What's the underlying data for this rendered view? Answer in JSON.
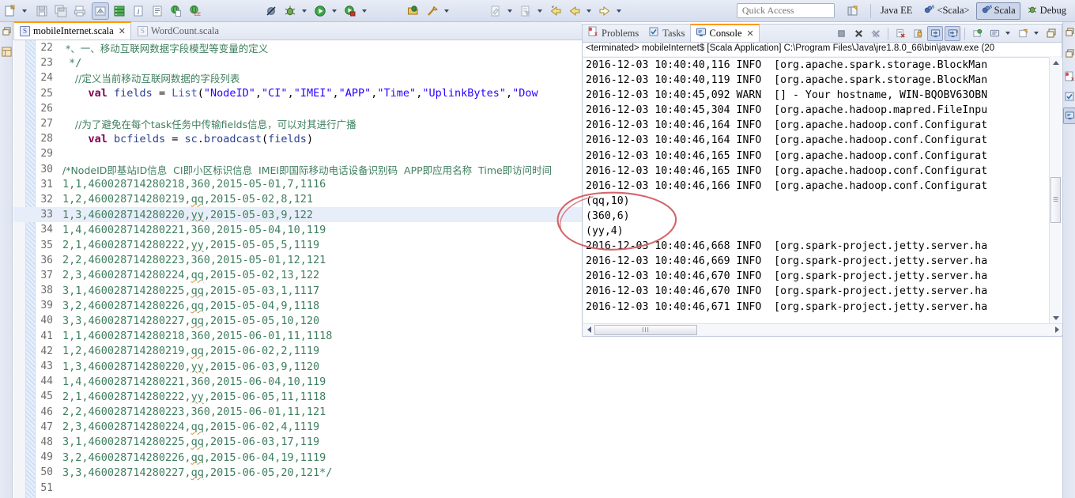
{
  "toolbar": {
    "groups": [
      {
        "name": "file-group",
        "items": [
          {
            "icon": "new-wizard-icon",
            "label": "New"
          },
          {
            "icon": "dropdown-arrow",
            "label": "New menu"
          }
        ]
      },
      {
        "name": "save-group",
        "items": [
          {
            "icon": "save-icon",
            "label": "Save"
          },
          {
            "icon": "save-all-icon",
            "label": "Save All"
          },
          {
            "icon": "print-icon",
            "label": "Print"
          }
        ]
      },
      {
        "name": "view-group",
        "items": [
          {
            "icon": "toggle-mark-occurrences-icon",
            "label": "Toggle Mark Occurrences"
          },
          {
            "icon": "server-icon",
            "label": "Servers"
          },
          {
            "icon": "info-icon",
            "label": "Information"
          },
          {
            "icon": "document-icon",
            "label": "Document"
          },
          {
            "icon": "web-browser-icon",
            "label": "Web Browser"
          },
          {
            "icon": "web-ee-icon",
            "label": "Java EE Browser"
          }
        ]
      },
      {
        "name": "run-group",
        "items": [
          {
            "icon": "skip-breakpoints-icon",
            "label": "Skip All Breakpoints"
          },
          {
            "icon": "debug-icon",
            "label": "Debug"
          },
          {
            "icon": "dropdown-arrow",
            "label": "Debug menu"
          },
          {
            "icon": "run-icon",
            "label": "Run"
          },
          {
            "icon": "dropdown-arrow",
            "label": "Run menu"
          },
          {
            "icon": "run-external-icon",
            "label": "External Tools"
          },
          {
            "icon": "dropdown-arrow",
            "label": "External Tools menu"
          }
        ]
      },
      {
        "name": "search-group",
        "items": [
          {
            "icon": "open-type-icon",
            "label": "Open Type"
          },
          {
            "icon": "search-icon",
            "label": "Search"
          },
          {
            "icon": "dropdown-arrow",
            "label": "Search menu"
          }
        ]
      },
      {
        "name": "nav-group",
        "items": [
          {
            "icon": "last-edit-location-icon",
            "label": "Last Edit Location"
          },
          {
            "icon": "dropdown-arrow",
            "label": "Last Edit Location menu"
          },
          {
            "icon": "next-annotation-icon",
            "label": "Next Annotation"
          },
          {
            "icon": "dropdown-arrow",
            "label": "Next Annotation menu"
          },
          {
            "icon": "back-icon",
            "label": "Back"
          },
          {
            "icon": "back-history-icon",
            "label": "Back History"
          },
          {
            "icon": "dropdown-arrow",
            "label": "Back menu"
          },
          {
            "icon": "forward-icon",
            "label": "Forward"
          },
          {
            "icon": "dropdown-arrow",
            "label": "Forward menu"
          }
        ]
      }
    ],
    "quick_access_placeholder": "Quick Access"
  },
  "perspective_bar": {
    "open_perspective_icon": "open-perspective-icon",
    "items": [
      {
        "label": "Java EE",
        "icon": "java-ee-perspective-icon",
        "active": false,
        "has_icon": false
      },
      {
        "label": "<Scala>",
        "icon": "scala-perspective-icon",
        "active": false,
        "has_icon": true
      },
      {
        "label": "Scala",
        "icon": "scala-perspective-icon",
        "active": true,
        "has_icon": true
      },
      {
        "label": "Debug",
        "icon": "debug-perspective-icon",
        "active": false,
        "has_icon": true
      }
    ]
  },
  "left_rail": {
    "items": [
      {
        "icon": "restore-icon",
        "label": "Restore"
      },
      {
        "icon": "package-explorer-icon",
        "label": "Package Explorer"
      }
    ]
  },
  "right_rail": {
    "items": [
      {
        "icon": "restore-icon",
        "label": "Restore"
      },
      {
        "icon": "restore-icon",
        "label": "Restore"
      },
      {
        "icon": "problems-icon",
        "label": "Problems"
      },
      {
        "icon": "tasks-icon",
        "label": "Tasks"
      },
      {
        "icon": "console-icon",
        "label": "Console",
        "selected": true
      }
    ]
  },
  "editor": {
    "tabs": [
      {
        "label": "mobileInternet.scala",
        "active": true,
        "closable": true,
        "icon": "scala-file-icon"
      },
      {
        "label": "WordCount.scala",
        "active": false,
        "closable": false,
        "icon": "scala-file-icon"
      }
    ],
    "first_line_number": 22,
    "current_line": 33,
    "lines": [
      {
        "n": 22,
        "tokens": [
          {
            "t": "cmt",
            "v": " *、一、移动互联网数据字段模型等变量的定义",
            "cn": true
          }
        ]
      },
      {
        "n": 23,
        "tokens": [
          {
            "t": "cmt",
            "v": " */"
          }
        ]
      },
      {
        "n": 24,
        "tokens": [
          {
            "t": "cmt",
            "v": "    //定义当前移动互联网数据的字段列表",
            "cn": true
          }
        ]
      },
      {
        "n": 25,
        "tokens": [
          {
            "t": "pl",
            "v": "    "
          },
          {
            "t": "kw",
            "v": "val"
          },
          {
            "t": "pl",
            "v": " "
          },
          {
            "t": "id",
            "v": "fields"
          },
          {
            "t": "pl",
            "v": " = "
          },
          {
            "t": "type",
            "v": "List"
          },
          {
            "t": "pl",
            "v": "("
          },
          {
            "t": "str",
            "v": "\"NodeID\""
          },
          {
            "t": "pl",
            "v": ","
          },
          {
            "t": "str",
            "v": "\"CI\""
          },
          {
            "t": "pl",
            "v": ","
          },
          {
            "t": "str",
            "v": "\"IMEI\""
          },
          {
            "t": "pl",
            "v": ","
          },
          {
            "t": "str",
            "v": "\"APP\""
          },
          {
            "t": "pl",
            "v": ","
          },
          {
            "t": "str",
            "v": "\"Time\""
          },
          {
            "t": "pl",
            "v": ","
          },
          {
            "t": "str",
            "v": "\"UplinkBytes\""
          },
          {
            "t": "pl",
            "v": ","
          },
          {
            "t": "str",
            "v": "\"Dow"
          }
        ]
      },
      {
        "n": 26,
        "tokens": []
      },
      {
        "n": 27,
        "tokens": [
          {
            "t": "cmt",
            "v": "    //为了避免在每个task任务中传输fields信息，可以对其进行广播",
            "cn": true
          }
        ]
      },
      {
        "n": 28,
        "tokens": [
          {
            "t": "pl",
            "v": "    "
          },
          {
            "t": "kw",
            "v": "val"
          },
          {
            "t": "pl",
            "v": " "
          },
          {
            "t": "id",
            "v": "bcfields"
          },
          {
            "t": "pl",
            "v": " = "
          },
          {
            "t": "id",
            "v": "sc"
          },
          {
            "t": "pl",
            "v": "."
          },
          {
            "t": "id",
            "v": "broadcast"
          },
          {
            "t": "pl",
            "v": "("
          },
          {
            "t": "id",
            "v": "fields"
          },
          {
            "t": "pl",
            "v": ")"
          }
        ]
      },
      {
        "n": 29,
        "tokens": []
      },
      {
        "n": 30,
        "tokens": [
          {
            "t": "cmt",
            "v": "/*NodeID即基站ID信息  CI即小区标识信息  IMEI即国际移动电话设备识别码  APP即应用名称  Time即访问时间",
            "cn": true
          }
        ]
      },
      {
        "n": 31,
        "tokens": [
          {
            "t": "cmt",
            "v": "1,1,460028714280218,360,2015-05-01,7,1116"
          }
        ]
      },
      {
        "n": 32,
        "tokens": [
          {
            "t": "cmt",
            "v": "1,2,460028714280219,"
          },
          {
            "t": "cmt-sq",
            "v": "qq"
          },
          {
            "t": "cmt",
            "v": ",2015-05-02,8,121"
          }
        ]
      },
      {
        "n": 33,
        "tokens": [
          {
            "t": "cmt",
            "v": "1,3,460028714280220,"
          },
          {
            "t": "cmt-sq",
            "v": "yy"
          },
          {
            "t": "cmt",
            "v": ",2015-05-03,9,122"
          }
        ]
      },
      {
        "n": 34,
        "tokens": [
          {
            "t": "cmt",
            "v": "1,4,460028714280221,360,2015-05-04,10,119"
          }
        ]
      },
      {
        "n": 35,
        "tokens": [
          {
            "t": "cmt",
            "v": "2,1,460028714280222,"
          },
          {
            "t": "cmt-sq",
            "v": "yy"
          },
          {
            "t": "cmt",
            "v": ",2015-05-05,5,1119"
          }
        ]
      },
      {
        "n": 36,
        "tokens": [
          {
            "t": "cmt",
            "v": "2,2,460028714280223,360,2015-05-01,12,121"
          }
        ]
      },
      {
        "n": 37,
        "tokens": [
          {
            "t": "cmt",
            "v": "2,3,460028714280224,"
          },
          {
            "t": "cmt-sq",
            "v": "qq"
          },
          {
            "t": "cmt",
            "v": ",2015-05-02,13,122"
          }
        ]
      },
      {
        "n": 38,
        "tokens": [
          {
            "t": "cmt",
            "v": "3,1,460028714280225,"
          },
          {
            "t": "cmt-sq",
            "v": "qq"
          },
          {
            "t": "cmt",
            "v": ",2015-05-03,1,1117"
          }
        ]
      },
      {
        "n": 39,
        "tokens": [
          {
            "t": "cmt",
            "v": "3,2,460028714280226,"
          },
          {
            "t": "cmt-sq",
            "v": "qq"
          },
          {
            "t": "cmt",
            "v": ",2015-05-04,9,1118"
          }
        ]
      },
      {
        "n": 40,
        "tokens": [
          {
            "t": "cmt",
            "v": "3,3,460028714280227,"
          },
          {
            "t": "cmt-sq",
            "v": "qq"
          },
          {
            "t": "cmt",
            "v": ",2015-05-05,10,120"
          }
        ]
      },
      {
        "n": 41,
        "tokens": [
          {
            "t": "cmt",
            "v": "1,1,460028714280218,360,2015-06-01,11,1118"
          }
        ]
      },
      {
        "n": 42,
        "tokens": [
          {
            "t": "cmt",
            "v": "1,2,460028714280219,"
          },
          {
            "t": "cmt-sq",
            "v": "qq"
          },
          {
            "t": "cmt",
            "v": ",2015-06-02,2,1119"
          }
        ]
      },
      {
        "n": 43,
        "tokens": [
          {
            "t": "cmt",
            "v": "1,3,460028714280220,"
          },
          {
            "t": "cmt-sq",
            "v": "yy"
          },
          {
            "t": "cmt",
            "v": ",2015-06-03,9,1120"
          }
        ]
      },
      {
        "n": 44,
        "tokens": [
          {
            "t": "cmt",
            "v": "1,4,460028714280221,360,2015-06-04,10,119"
          }
        ]
      },
      {
        "n": 45,
        "tokens": [
          {
            "t": "cmt",
            "v": "2,1,460028714280222,"
          },
          {
            "t": "cmt-sq",
            "v": "yy"
          },
          {
            "t": "cmt",
            "v": ",2015-06-05,11,1118"
          }
        ]
      },
      {
        "n": 46,
        "tokens": [
          {
            "t": "cmt",
            "v": "2,2,460028714280223,360,2015-06-01,11,121"
          }
        ]
      },
      {
        "n": 47,
        "tokens": [
          {
            "t": "cmt",
            "v": "2,3,460028714280224,"
          },
          {
            "t": "cmt-sq",
            "v": "qq"
          },
          {
            "t": "cmt",
            "v": ",2015-06-02,4,1119"
          }
        ]
      },
      {
        "n": 48,
        "tokens": [
          {
            "t": "cmt",
            "v": "3,1,460028714280225,"
          },
          {
            "t": "cmt-sq",
            "v": "qq"
          },
          {
            "t": "cmt",
            "v": ",2015-06-03,17,119"
          }
        ]
      },
      {
        "n": 49,
        "tokens": [
          {
            "t": "cmt",
            "v": "3,2,460028714280226,"
          },
          {
            "t": "cmt-sq",
            "v": "qq"
          },
          {
            "t": "cmt",
            "v": ",2015-06-04,19,1119"
          }
        ]
      },
      {
        "n": 50,
        "tokens": [
          {
            "t": "cmt",
            "v": "3,3,460028714280227,"
          },
          {
            "t": "cmt-sq",
            "v": "qq"
          },
          {
            "t": "cmt",
            "v": ",2015-06-05,20,121*/"
          }
        ]
      },
      {
        "n": 51,
        "tokens": []
      }
    ]
  },
  "console": {
    "tabs": [
      {
        "label": "Problems",
        "icon": "problems-icon",
        "active": false,
        "closable": false
      },
      {
        "label": "Tasks",
        "icon": "tasks-icon",
        "active": false,
        "closable": false
      },
      {
        "label": "Console",
        "icon": "console-icon",
        "active": true,
        "closable": true
      }
    ],
    "toolbar": [
      {
        "icon": "terminate-icon",
        "label": "Terminate",
        "pressed": false
      },
      {
        "icon": "remove-launch-icon",
        "label": "Remove Launch",
        "pressed": false
      },
      {
        "icon": "remove-all-terminated-icon",
        "label": "Remove All Terminated Launches",
        "pressed": false
      },
      {
        "icon": "clear-console-icon",
        "label": "Clear Console",
        "pressed": false
      },
      {
        "icon": "scroll-lock-icon",
        "label": "Scroll Lock",
        "pressed": false
      },
      {
        "icon": "show-console-on-output-icon",
        "label": "Show Console When Standard Out Changes",
        "pressed": true
      },
      {
        "icon": "show-console-on-error-icon",
        "label": "Show Console When Standard Error Changes",
        "pressed": true
      },
      {
        "icon": "pin-console-icon",
        "label": "Pin Console",
        "pressed": false
      },
      {
        "icon": "display-selected-console-icon",
        "label": "Display Selected Console",
        "pressed": false
      },
      {
        "icon": "dropdown-arrow",
        "label": "Display Selected Console menu",
        "pressed": false
      },
      {
        "icon": "open-console-icon",
        "label": "Open Console",
        "pressed": false
      },
      {
        "icon": "dropdown-arrow",
        "label": "Open Console menu",
        "pressed": false
      },
      {
        "icon": "minimize-icon",
        "label": "Minimize",
        "pressed": false
      }
    ],
    "title": "<terminated> mobileInternet$ [Scala Application] C:\\Program Files\\Java\\jre1.8.0_66\\bin\\javaw.exe (20",
    "lines": [
      "2016-12-03 10:40:40,116 INFO  [org.apache.spark.storage.BlockMan",
      "2016-12-03 10:40:40,119 INFO  [org.apache.spark.storage.BlockMan",
      "2016-12-03 10:40:45,092 WARN  [] - Your hostname, WIN-BQOBV63OBN",
      "2016-12-03 10:40:45,304 INFO  [org.apache.hadoop.mapred.FileInpu",
      "2016-12-03 10:40:46,164 INFO  [org.apache.hadoop.conf.Configurat",
      "2016-12-03 10:40:46,164 INFO  [org.apache.hadoop.conf.Configurat",
      "2016-12-03 10:40:46,165 INFO  [org.apache.hadoop.conf.Configurat",
      "2016-12-03 10:40:46,165 INFO  [org.apache.hadoop.conf.Configurat",
      "2016-12-03 10:40:46,166 INFO  [org.apache.hadoop.conf.Configurat",
      "(qq,10)",
      "(360,6)",
      "(yy,4)",
      "2016-12-03 10:40:46,668 INFO  [org.spark-project.jetty.server.ha",
      "2016-12-03 10:40:46,669 INFO  [org.spark-project.jetty.server.ha",
      "2016-12-03 10:40:46,670 INFO  [org.spark-project.jetty.server.ha",
      "2016-12-03 10:40:46,670 INFO  [org.spark-project.jetty.server.ha",
      "2016-12-03 10:40:46,671 INFO  [org.spark-project.jetty.server.ha"
    ],
    "hscroll_thumb_glyph": "III"
  },
  "annotation": {
    "shape": "ellipse",
    "color": "#d4656a",
    "encircles": [
      "(qq,10)",
      "(360,6)",
      "(yy,4)"
    ]
  }
}
